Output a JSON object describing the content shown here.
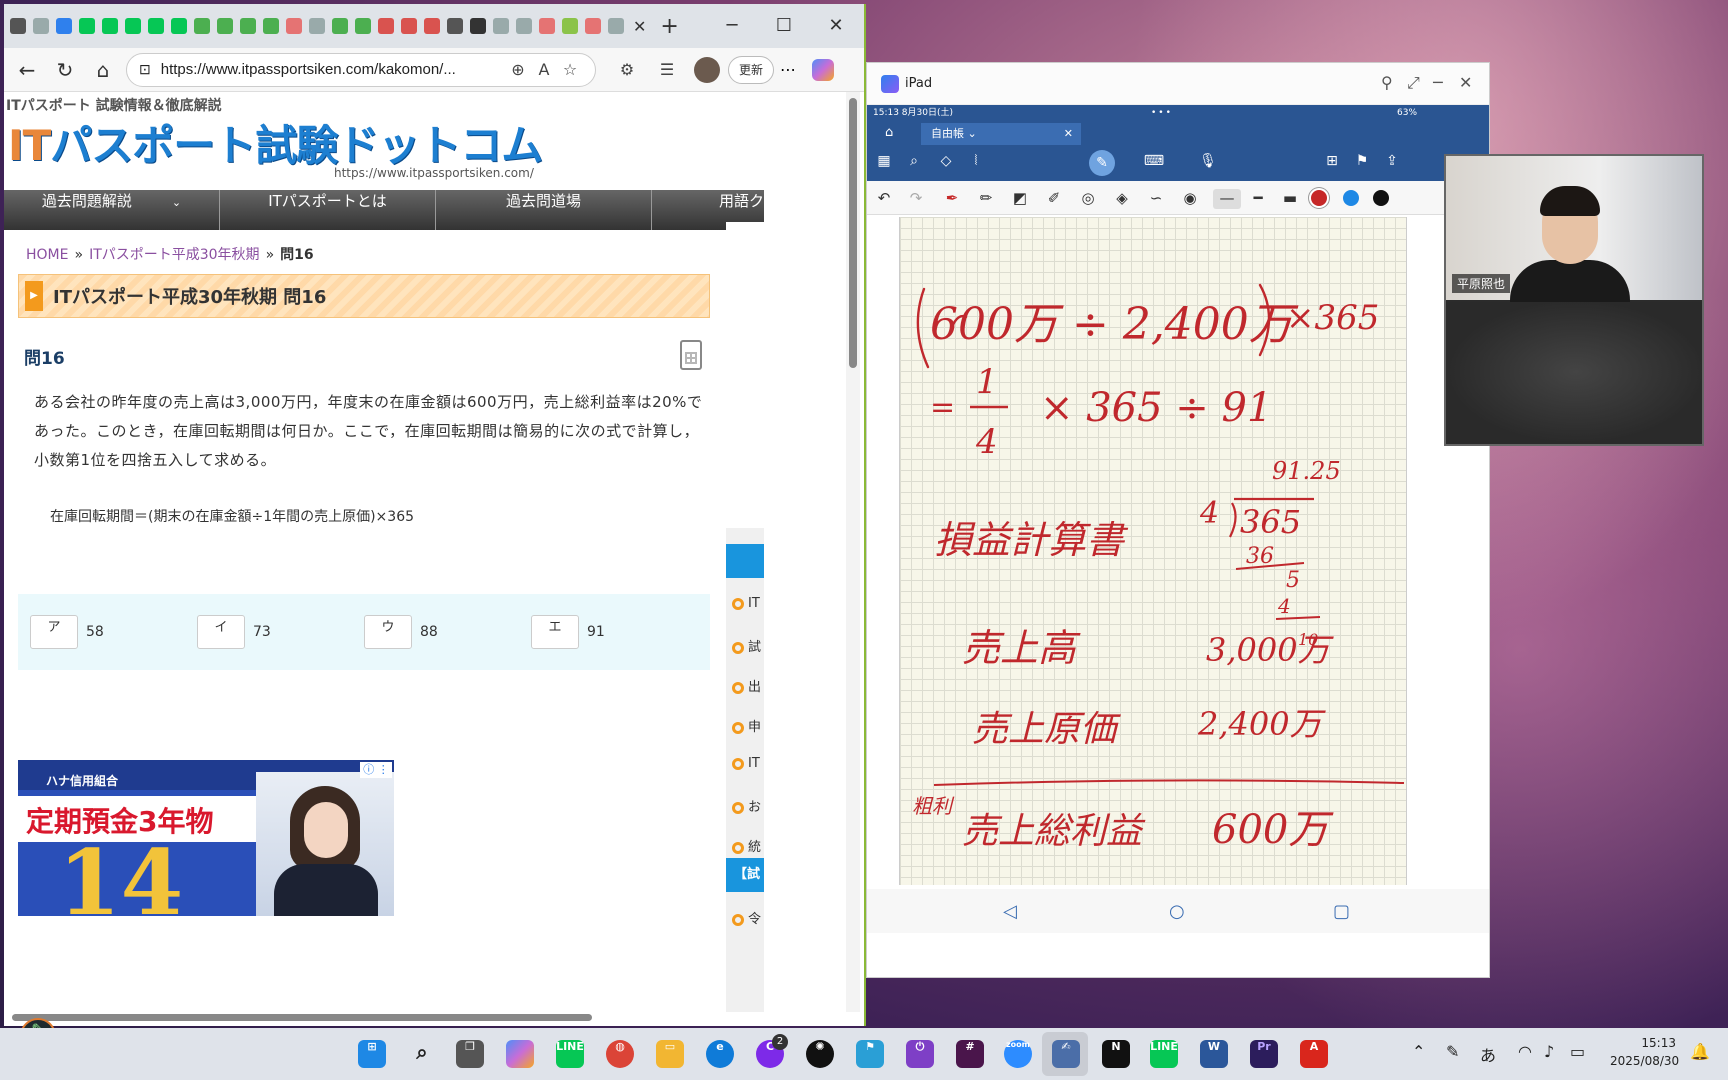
{
  "browser": {
    "url": "https://www.itpassportsiken.com/kakomon/...",
    "update_label": "更新"
  },
  "site": {
    "tagline": "ITパスポート 試験情報＆徹底解説",
    "logo_it": "IT",
    "logo_rest": "パスポート試験ドットコム",
    "logo_url": "https://www.itpassportsiken.com/",
    "nav": [
      "過去問題解説",
      "ITパスポートとは",
      "過去問道場",
      "用語ク"
    ]
  },
  "breadcrumb": {
    "home": "HOME",
    "parent": "ITパスポート平成30年秋期",
    "current": "問16"
  },
  "page_title": "ITパスポート平成30年秋期 問16",
  "question": {
    "heading": "問16",
    "body": "ある会社の昨年度の売上高は3,000万円，年度末の在庫金額は600万円，売上総利益率は20%であった。このとき，在庫回転期間は何日か。ここで，在庫回転期間は簡易的に次の式で計算し，小数第1位を四捨五入して求める。",
    "formula": "在庫回転期間＝(期末の在庫金額÷1年間の売上原価)×365"
  },
  "answers": [
    {
      "key": "ア",
      "value": "58"
    },
    {
      "key": "イ",
      "value": "73"
    },
    {
      "key": "ウ",
      "value": "88"
    },
    {
      "key": "エ",
      "value": "91"
    }
  ],
  "ad": {
    "bank": "ハナ信用組合",
    "headline": "定期預金3年物",
    "rate": "14"
  },
  "sidebar_items": [
    "IT",
    "試",
    "出",
    "申",
    "IT",
    "お",
    "統"
  ],
  "sidebar_heading": "【試",
  "sidebar_last": "令",
  "ipad": {
    "title": "iPad",
    "status_time": "15:13  8月30日(土)",
    "battery": "63%",
    "tab_label": "自由帳"
  },
  "video": {
    "name": "平原照也"
  },
  "taskbar": {
    "time": "15:13",
    "date": "2025/08/30",
    "ime": "あ",
    "badge": "2"
  }
}
